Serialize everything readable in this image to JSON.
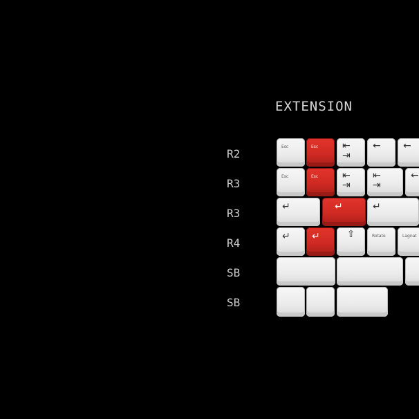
{
  "title": "EXTENSION",
  "rows": [
    "R2",
    "R3",
    "R3",
    "R4",
    "SB",
    "SB"
  ],
  "keys": {
    "esc": "Esc",
    "del": "Rotate",
    "legend_blank": "Lagnat"
  },
  "icons": {
    "tab": "tab-icon",
    "backspace": "backspace-arrow-icon",
    "enter": "enter-icon",
    "shift": "shift-up-icon"
  },
  "colors": {
    "background": "#000000",
    "accent": "#d3302a",
    "keycap": "#eeeeee"
  }
}
